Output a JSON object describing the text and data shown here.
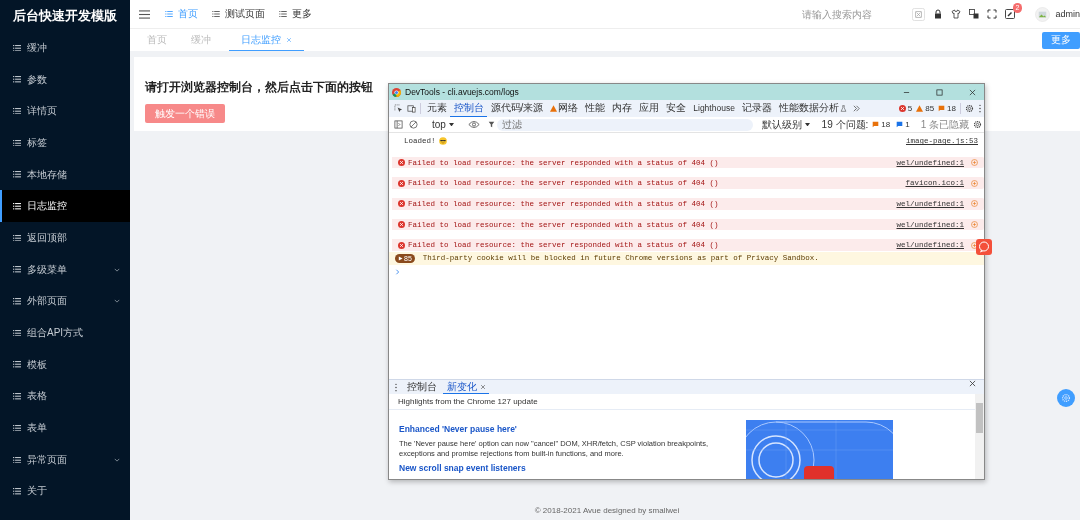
{
  "sidebar": {
    "logo": "后台快速开发模版",
    "items": [
      {
        "label": "缓冲",
        "selected": false,
        "expandable": false
      },
      {
        "label": "参数",
        "selected": false,
        "expandable": false
      },
      {
        "label": "详情页",
        "selected": false,
        "expandable": false
      },
      {
        "label": "标签",
        "selected": false,
        "expandable": false
      },
      {
        "label": "本地存储",
        "selected": false,
        "expandable": false
      },
      {
        "label": "日志监控",
        "selected": true,
        "expandable": false
      },
      {
        "label": "返回顶部",
        "selected": false,
        "expandable": false
      },
      {
        "label": "多级菜单",
        "selected": false,
        "expandable": true
      },
      {
        "label": "外部页面",
        "selected": false,
        "expandable": true
      },
      {
        "label": "组合API方式",
        "selected": false,
        "expandable": false
      },
      {
        "label": "模板",
        "selected": false,
        "expandable": false
      },
      {
        "label": "表格",
        "selected": false,
        "expandable": false
      },
      {
        "label": "表单",
        "selected": false,
        "expandable": false
      },
      {
        "label": "异常页面",
        "selected": false,
        "expandable": true
      },
      {
        "label": "关于",
        "selected": false,
        "expandable": false
      }
    ]
  },
  "topbar": {
    "nav": [
      {
        "label": "首页",
        "selected": true
      },
      {
        "label": "测试页面",
        "selected": false
      },
      {
        "label": "更多",
        "selected": false
      }
    ],
    "search": {
      "placeholder": "请输入搜索内容"
    },
    "notification_badge": "2",
    "user": "admin"
  },
  "tabs": [
    {
      "label": "首页",
      "selected": false,
      "closable": false
    },
    {
      "label": "缓冲",
      "selected": false,
      "closable": false
    },
    {
      "label": "日志监控",
      "selected": true,
      "closable": true
    }
  ],
  "more_button": "更多",
  "content": {
    "heading": "请打开浏览器控制台，然后点击下面的按钮",
    "button": "触发一个错误"
  },
  "footer": "© 2018-2021 Avue designed by smallwei",
  "devtools": {
    "title": "DevTools - cli.avuejs.com/logs",
    "panels": [
      {
        "label": "元素",
        "selected": false,
        "kind": "plain"
      },
      {
        "label": "控制台",
        "selected": true,
        "kind": "plain"
      },
      {
        "label": "源代码/来源",
        "selected": false,
        "kind": "plain"
      },
      {
        "label": "网络",
        "selected": false,
        "kind": "warning"
      },
      {
        "label": "性能",
        "selected": false,
        "kind": "plain"
      },
      {
        "label": "内存",
        "selected": false,
        "kind": "plain"
      },
      {
        "label": "应用",
        "selected": false,
        "kind": "plain"
      },
      {
        "label": "安全",
        "selected": false,
        "kind": "plain"
      },
      {
        "label": "Lighthouse",
        "selected": false,
        "kind": "plain"
      },
      {
        "label": "记录器",
        "selected": false,
        "kind": "plain"
      },
      {
        "label": "性能数据分析",
        "selected": false,
        "kind": "experimental"
      }
    ],
    "counts": {
      "errors": "5",
      "warnings": "85",
      "issues": "18"
    },
    "filter": {
      "context": "top",
      "placeholder": "过滤",
      "level": "默认级别",
      "issues_label": "19 个问题:",
      "issue_errors": "18",
      "issue_info": "1",
      "hidden": "1 条已隐藏"
    },
    "messages": [
      {
        "kind": "log",
        "text": "Loaded!",
        "source": "image-page.js:53"
      },
      {
        "kind": "error",
        "text": "Failed to load resource: the server responded with a status of 404 ()",
        "source": "wel/undefined:1"
      },
      {
        "kind": "error",
        "text": "Failed to load resource: the server responded with a status of 404 ()",
        "source": "favicon.ico:1"
      },
      {
        "kind": "error",
        "text": "Failed to load resource: the server responded with a status of 404 ()",
        "source": "wel/undefined:1"
      },
      {
        "kind": "error",
        "text": "Failed to load resource: the server responded with a status of 404 ()",
        "source": "wel/undefined:1"
      },
      {
        "kind": "error",
        "text": "Failed to load resource: the server responded with a status of 404 ()",
        "source": "wel/undefined:1"
      },
      {
        "kind": "issue",
        "count": "85",
        "text": "Third-party cookie will be blocked in future Chrome versions as part of Privacy Sandbox."
      }
    ],
    "drawer": {
      "tabs": [
        {
          "label": "控制台",
          "selected": false,
          "closable": false
        },
        {
          "label": "新变化",
          "selected": true,
          "closable": true
        }
      ],
      "subtitle": "Highlights from the Chrome 127 update",
      "articles": [
        {
          "title": "Enhanced 'Never pause here'",
          "body": "The 'Never pause here' option can now \"cancel\" DOM, XHR/fetch, CSP violation breakpoints, exceptions and promise rejections from built-in functions, and more."
        },
        {
          "title": "New scroll snap event listeners"
        }
      ]
    }
  }
}
